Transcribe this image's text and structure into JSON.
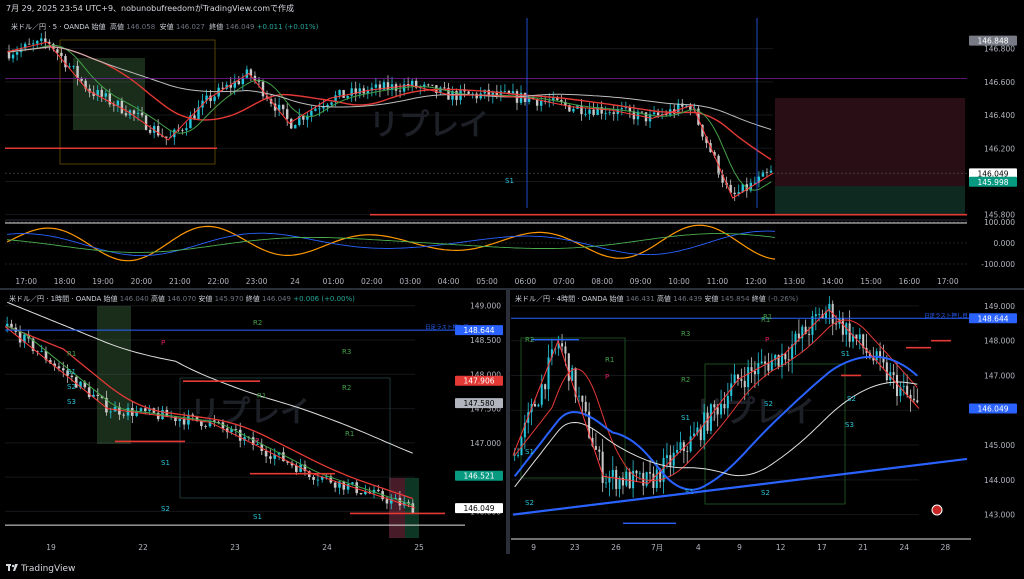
{
  "header": {
    "caption": "7月 29, 2025 23:54 UTC+9、nobunobufreedomがTradingView.comで作成"
  },
  "branding": {
    "logo_text": "TradingView"
  },
  "colors": {
    "up": "#26c6da",
    "down": "#c8c8c8",
    "ma_red": "#e53935",
    "ma_green": "#43a047",
    "ma_white": "#bdbdbd",
    "ma_blue": "#2962ff",
    "zigzag": "#ff3b3b",
    "stoch_orange": "#ff9800",
    "stoch_blue": "#2962ff",
    "stoch_green": "#4caf50"
  },
  "charts": [
    {
      "id": "5m",
      "legend": {
        "symbol": "米ドル／円 · 5 · OANDA",
        "open_label": "始値",
        "open": "",
        "high_label": "高値",
        "high": "146.058",
        "low_label": "安値",
        "low": "146.027",
        "close_label": "終値",
        "close": "146.049",
        "change": "+0.011 (+0.01%)"
      },
      "price_scale": [
        "146.800",
        "146.600",
        "146.400",
        "146.200",
        "146.000",
        "145.800"
      ],
      "price_tags": [
        {
          "text": "146.848",
          "bg": "#787b86",
          "fg": "#ffffff",
          "price": 146.848
        },
        {
          "text": "146.049",
          "bg": "#ffffff",
          "fg": "#000000",
          "price": 146.049
        },
        {
          "text": "145.998",
          "bg": "#089981",
          "fg": "#ffffff",
          "price": 145.998
        }
      ],
      "osc_scale": [
        "100.000",
        "0.000",
        "-100.000"
      ],
      "time_axis": [
        "17:00",
        "18:00",
        "19:00",
        "20:00",
        "21:00",
        "22:00",
        "23:00",
        "24",
        "01:00",
        "02:00",
        "03:00",
        "04:00",
        "05:00",
        "06:00",
        "07:00",
        "08:00",
        "09:00",
        "10:00",
        "11:00",
        "12:00",
        "13:00",
        "14:00",
        "15:00",
        "16:00",
        "17:00"
      ],
      "pivot_labels": [
        "S1"
      ],
      "watermark": "リプレイ"
    },
    {
      "id": "1h",
      "legend": {
        "symbol": "米ドル／円 · 1時間 · OANDA",
        "open_label": "始値",
        "open": "146.040",
        "high_label": "高値",
        "high": "146.070",
        "low_label": "安値",
        "low": "145.970",
        "close_label": "終値",
        "close": "146.049",
        "change": "+0.006 (+0.00%)"
      },
      "price_scale": [
        "149.000",
        "148.500",
        "148.000",
        "147.500",
        "147.000",
        "146.500",
        "146.000"
      ],
      "price_tags": [
        {
          "text": "148.644",
          "bg": "#2962ff",
          "fg": "#ffffff",
          "price": 148.644
        },
        {
          "text": "147.906",
          "bg": "#e53935",
          "fg": "#ffffff",
          "price": 147.906
        },
        {
          "text": "147.580",
          "bg": "#b2b5be",
          "fg": "#000000",
          "price": 147.58
        },
        {
          "text": "146.521",
          "bg": "#089981",
          "fg": "#ffffff",
          "price": 146.521
        },
        {
          "text": "146.049",
          "bg": "#ffffff",
          "fg": "#000000",
          "price": 146.049
        }
      ],
      "time_axis": [
        "19",
        "22",
        "23",
        "24",
        "25"
      ],
      "pivot_labels": [
        "R2",
        "R3",
        "R1",
        "P",
        "S1",
        "S2",
        "S3",
        "R1",
        "R2",
        "R1",
        "P",
        "S1",
        "S2",
        "S1"
      ],
      "line_note": "日足ラスト押し目",
      "watermark": "リプレイ"
    },
    {
      "id": "4h",
      "legend": {
        "symbol": "米ドル／円 · 4時間 · OANDA",
        "open_label": "始値",
        "open": "146.431",
        "high_label": "高値",
        "high": "146.439",
        "low_label": "安値",
        "low": "145.854",
        "close_label": "終値",
        "close": "",
        "change": "(-0.26%)"
      },
      "price_scale": [
        "149.000",
        "148.000",
        "147.000",
        "146.000",
        "145.000",
        "144.000",
        "143.000"
      ],
      "price_tags": [
        {
          "text": "148.644",
          "bg": "#2962ff",
          "fg": "#ffffff",
          "price": 148.644
        },
        {
          "text": "146.049",
          "bg": "#2962ff",
          "fg": "#ffffff",
          "price": 146.049
        }
      ],
      "time_axis": [
        "9",
        "23",
        "26",
        "7月",
        "4",
        "9",
        "12",
        "17",
        "21",
        "24",
        "28"
      ],
      "pivot_labels": [
        "R2",
        "R1",
        "P",
        "S1",
        "S2",
        "R3",
        "R2",
        "R1",
        "P",
        "S1",
        "S2",
        "S3",
        "R1",
        "S1",
        "S2",
        "S1",
        "S2"
      ],
      "line_note": "日足ラスト押し目",
      "watermark": "リプレイ"
    }
  ],
  "chart_data": [
    {
      "type": "line",
      "title": "米ドル／円 · 5 · OANDA",
      "x": [
        "17:00",
        "18:00",
        "19:00",
        "20:00",
        "21:00",
        "22:00",
        "23:00",
        "24",
        "01:00",
        "02:00",
        "03:00",
        "04:00",
        "05:00",
        "06:00",
        "07:00",
        "08:00",
        "09:00",
        "10:00",
        "11:00",
        "12:00"
      ],
      "ylim": [
        145.78,
        146.9
      ],
      "series": [
        {
          "values": [
            146.78,
            146.84,
            146.55,
            146.42,
            146.25,
            146.5,
            146.65,
            146.35,
            146.5,
            146.55,
            146.58,
            146.52,
            146.52,
            146.5,
            146.45,
            146.43,
            146.38,
            146.46,
            145.9,
            146.05
          ]
        }
      ]
    },
    {
      "type": "line",
      "title": "米ドル／円 · 1時間 · OANDA",
      "x": [
        "19",
        "22",
        "23",
        "24",
        "25"
      ],
      "ylim": [
        145.7,
        149.2
      ],
      "series": [
        {
          "values": [
            148.7,
            147.5,
            147.3,
            146.55,
            146.05
          ]
        }
      ]
    },
    {
      "type": "line",
      "title": "米ドル／円 · 4時間 · OANDA",
      "x": [
        "9",
        "23",
        "26",
        "7月",
        "4",
        "9",
        "12",
        "17",
        "21",
        "24"
      ],
      "ylim": [
        142.5,
        149.4
      ],
      "series": [
        {
          "values": [
            144.7,
            148.0,
            144.1,
            143.9,
            145.2,
            146.9,
            147.6,
            148.9,
            147.5,
            146.05
          ]
        }
      ]
    }
  ]
}
